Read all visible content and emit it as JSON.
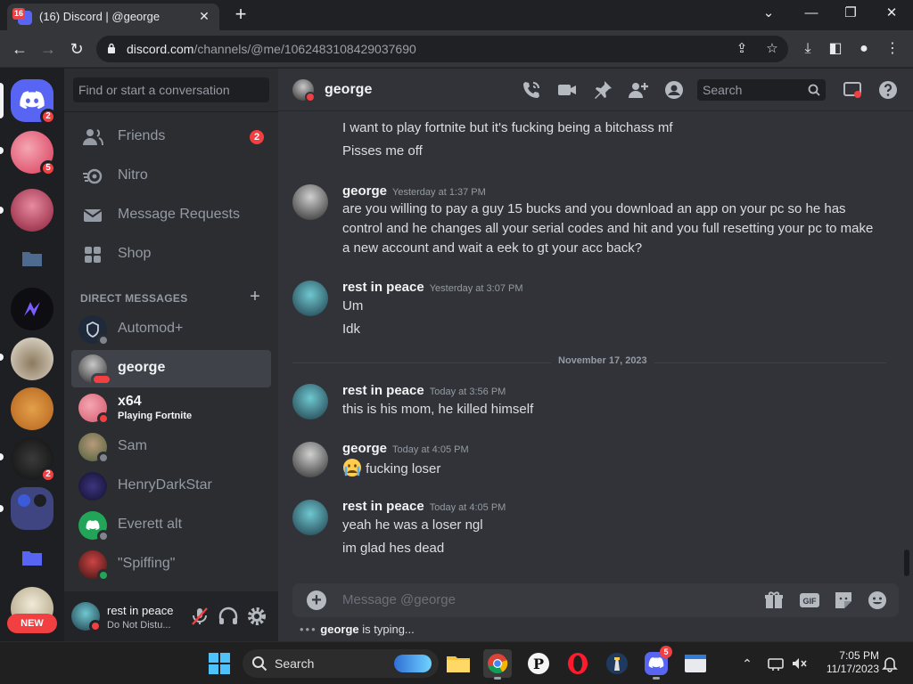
{
  "browser": {
    "tab_badge": "16",
    "tab_title": "(16) Discord | @george",
    "url_host": "discord.com",
    "url_path": "/channels/@me/1062483108429037690"
  },
  "guilds": [
    {
      "name": "home",
      "badge": "2"
    },
    {
      "name": "server-1",
      "badge": "5"
    },
    {
      "name": "server-2",
      "badge": ""
    },
    {
      "name": "folder",
      "badge": ""
    },
    {
      "name": "server-4",
      "badge": ""
    },
    {
      "name": "server-5",
      "badge": ""
    },
    {
      "name": "server-6",
      "badge": ""
    },
    {
      "name": "server-7",
      "badge": "2"
    },
    {
      "name": "folder-group",
      "badge": ""
    },
    {
      "name": "folder-2",
      "badge": ""
    },
    {
      "name": "server-10",
      "badge": ""
    }
  ],
  "new_badge": "NEW",
  "sidebar": {
    "search_placeholder": "Find or start a conversation",
    "nav": [
      {
        "label": "Friends",
        "count": "2"
      },
      {
        "label": "Nitro",
        "count": ""
      },
      {
        "label": "Message Requests",
        "count": ""
      },
      {
        "label": "Shop",
        "count": ""
      }
    ],
    "dm_header": "DIRECT MESSAGES",
    "dms": [
      {
        "name": "Automod+",
        "sub": "",
        "status": "offline",
        "color": "#1e2a3a"
      },
      {
        "name": "george",
        "sub": "",
        "status": "dnd",
        "color": "#4a4d52",
        "active": true
      },
      {
        "name": "x64",
        "sub": "Playing Fortnite",
        "status": "dnd",
        "color": "#d4566a"
      },
      {
        "name": "Sam",
        "sub": "",
        "status": "offline",
        "color": "#5b6e3f"
      },
      {
        "name": "HenryDarkStar",
        "sub": "",
        "status": "",
        "color": "#26224d"
      },
      {
        "name": "Everett alt",
        "sub": "",
        "status": "offline",
        "color": "#23a559"
      },
      {
        "name": "\"Spiffing\"",
        "sub": "",
        "status": "online",
        "color": "#7a2a2a"
      }
    ]
  },
  "user_panel": {
    "name": "rest in peace",
    "status": "Do Not Distu..."
  },
  "chat": {
    "header_name": "george",
    "search_placeholder": "Search",
    "messages": [
      {
        "author": "",
        "time": "",
        "lines": [
          "I want to play fortnite but it's fucking being a bitchass mf",
          "Pisses me off"
        ]
      },
      {
        "author": "george",
        "time": "Yesterday at 1:37 PM",
        "lines": [
          "are you willing to pay a guy 15 bucks and you download an app on your pc so he has control and he changes all your serial codes and hit and you full resetting your pc to make a new account and wait a eek to gt your acc back?"
        ]
      },
      {
        "author": "rest in peace",
        "time": "Yesterday at 3:07 PM",
        "lines": [
          "Um",
          "Idk"
        ]
      },
      {
        "author": "rest in peace",
        "time": "Today at 3:56 PM",
        "lines": [
          "this is his mom, he killed himself"
        ]
      },
      {
        "author": "george",
        "time": "Today at 4:05 PM",
        "lines": [
          "fucking loser"
        ]
      },
      {
        "author": "rest in peace",
        "time": "Today at 4:05 PM",
        "lines": [
          "yeah he was a loser ngl",
          "im glad hes dead"
        ]
      }
    ],
    "date_divider": "November 17, 2023",
    "composer_placeholder": "Message @george",
    "typing_user": "george",
    "typing_text": " is typing..."
  },
  "taskbar": {
    "search_label": "Search",
    "discord_badge": "5",
    "time": "7:05 PM",
    "date": "11/17/2023"
  }
}
